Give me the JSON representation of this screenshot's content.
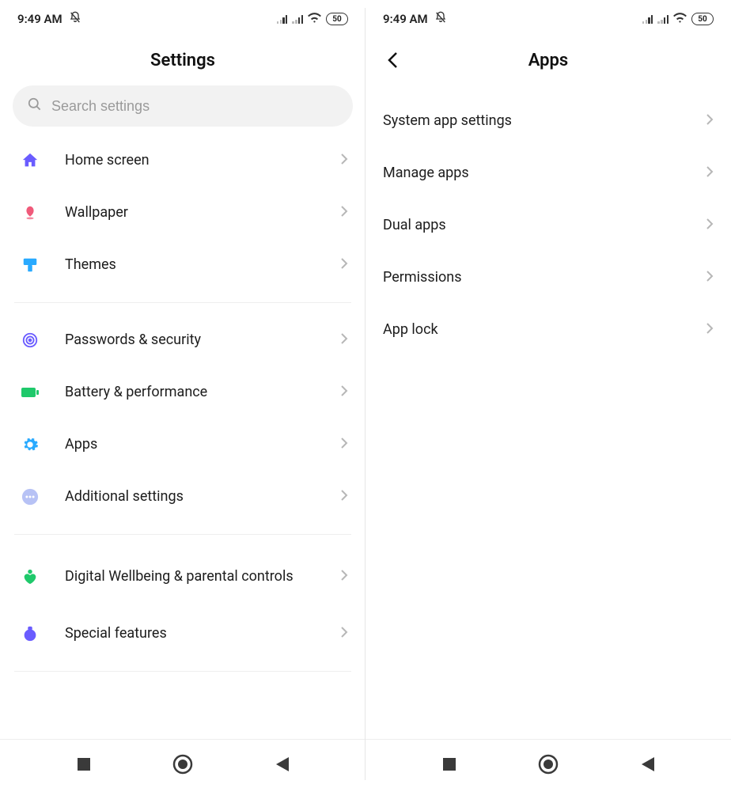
{
  "statusbar": {
    "time": "9:49 AM",
    "battery": "50"
  },
  "left": {
    "title": "Settings",
    "search_placeholder": "Search settings",
    "items": {
      "home_screen": "Home screen",
      "wallpaper": "Wallpaper",
      "themes": "Themes",
      "passwords_security": "Passwords & security",
      "battery_performance": "Battery & performance",
      "apps": "Apps",
      "additional_settings": "Additional settings",
      "digital_wellbeing": "Digital Wellbeing & parental controls",
      "special_features": "Special features"
    }
  },
  "right": {
    "title": "Apps",
    "items": {
      "system_app_settings": "System app settings",
      "manage_apps": "Manage apps",
      "dual_apps": "Dual apps",
      "permissions": "Permissions",
      "app_lock": "App lock"
    }
  }
}
